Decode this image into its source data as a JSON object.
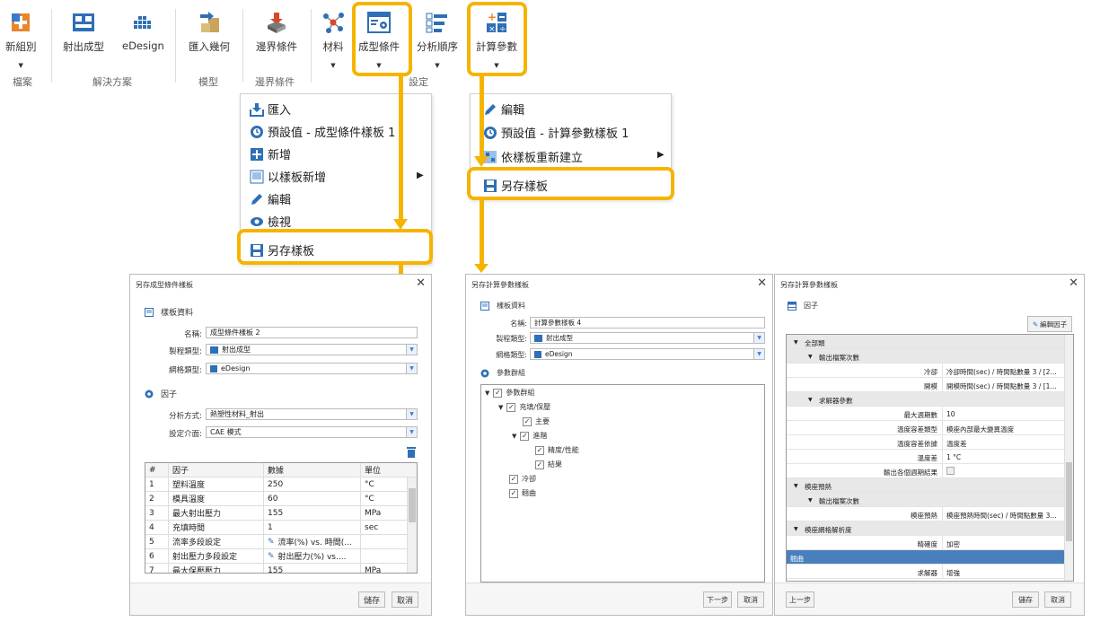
{
  "ribbon": {
    "buttons": [
      {
        "label": "新組別",
        "icon": "new-group-icon"
      },
      {
        "label": "射出成型",
        "icon": "injection-molding-icon"
      },
      {
        "label": "eDesign",
        "icon": "edesign-icon"
      },
      {
        "label": "匯入幾何",
        "icon": "import-geometry-icon"
      },
      {
        "label": "邊界條件",
        "icon": "boundary-condition-icon"
      },
      {
        "label": "材料",
        "icon": "material-icon"
      },
      {
        "label": "成型條件",
        "icon": "molding-condition-icon"
      },
      {
        "label": "分析順序",
        "icon": "analysis-sequence-icon"
      },
      {
        "label": "計算參數",
        "icon": "compute-params-icon"
      }
    ],
    "groups": [
      "檔案",
      "解決方案",
      "模型",
      "邊界條件",
      "設定"
    ]
  },
  "menu_left": {
    "items": [
      "匯入",
      "預設值 - 成型條件樣板 1",
      "新增",
      "以樣板新增",
      "編輯",
      "檢視",
      "另存樣板"
    ]
  },
  "menu_right": {
    "items": [
      "編輯",
      "預設值 - 計算參數樣板 1",
      "依樣板重新建立",
      "另存樣板"
    ]
  },
  "dialog1": {
    "title": "另存成型條件樣板",
    "section_template": "樣板資料",
    "name_label": "名稱:",
    "name_value": "成型條件樣板 2",
    "process_label": "製程類型:",
    "process_value": "射出成型",
    "mesh_label": "網格類型:",
    "mesh_value": "eDesign",
    "section_factor": "因子",
    "analysis_label": "分析方式:",
    "analysis_value": "熱塑性材料_射出",
    "ui_label": "設定介面:",
    "ui_value": "CAE 模式",
    "table_headers": [
      "#",
      "因子",
      "數據",
      "單位"
    ],
    "rows": [
      [
        "1",
        "塑料溫度",
        "250",
        "°C"
      ],
      [
        "2",
        "模具溫度",
        "60",
        "°C"
      ],
      [
        "3",
        "最大射出壓力",
        "155",
        "MPa"
      ],
      [
        "4",
        "充填時間",
        "1",
        "sec"
      ],
      [
        "5",
        "流率多段設定",
        "流率(%) vs. 時間(...",
        ""
      ],
      [
        "6",
        "射出壓力多段設定",
        "射出壓力(%) vs....",
        ""
      ],
      [
        "7",
        "最大保壓壓力",
        "155",
        "MPa"
      ]
    ],
    "save": "儲存",
    "cancel": "取消"
  },
  "dialog2": {
    "title": "另存計算參數樣板",
    "section_template": "樣板資料",
    "name_label": "名稱:",
    "name_value": "計算參數樣板 4",
    "process_label": "製程類型:",
    "process_value": "射出成型",
    "mesh_label": "網格類型:",
    "mesh_value": "eDesign",
    "section_group": "參數群組",
    "tree": [
      "參數群組",
      "充填/保壓",
      "主要",
      "進階",
      "精度/性能",
      "結果",
      "冷卻",
      "翹曲"
    ],
    "next": "下一步",
    "cancel": "取消"
  },
  "dialog3": {
    "title": "另存計算參數樣板",
    "section": "因子",
    "edit_factor": "編輯因子",
    "rows": [
      {
        "k": "全部類",
        "v": "",
        "lvl": 0
      },
      {
        "k": "輸出檔案次數",
        "v": "",
        "lvl": 1
      },
      {
        "k": "冷卻",
        "v": "冷卻時間(sec) / 時間點數量 3 / [2...",
        "lvl": 3
      },
      {
        "k": "開模",
        "v": "開模時間(sec) / 時間點數量 3 / [1...",
        "lvl": 3
      },
      {
        "k": "求解器參數",
        "v": "",
        "lvl": 1
      },
      {
        "k": "最大週期數",
        "v": "10",
        "lvl": 3
      },
      {
        "k": "溫度容差類型",
        "v": "模座內部最大變異溫度",
        "lvl": 3
      },
      {
        "k": "溫度容差依據",
        "v": "溫度差",
        "lvl": 3
      },
      {
        "k": "溫度差",
        "v": "1 °C",
        "lvl": 3
      },
      {
        "k": "輸出各個週期結果",
        "v": "",
        "lvl": 2
      },
      {
        "k": "模座預熱",
        "v": "",
        "lvl": 0
      },
      {
        "k": "輸出檔案次數",
        "v": "",
        "lvl": 1
      },
      {
        "k": "模座預熱",
        "v": "模座預熱時間(sec) / 時間點數量 3...",
        "lvl": 3
      },
      {
        "k": "模座網格解析度",
        "v": "",
        "lvl": 0
      },
      {
        "k": "精確度",
        "v": "加密",
        "lvl": 2
      },
      {
        "k": "翹曲",
        "v": "",
        "lvl": -1
      },
      {
        "k": "求解器",
        "v": "增強",
        "lvl": 2
      }
    ],
    "prev": "上一步",
    "save": "儲存",
    "cancel": "取消"
  }
}
